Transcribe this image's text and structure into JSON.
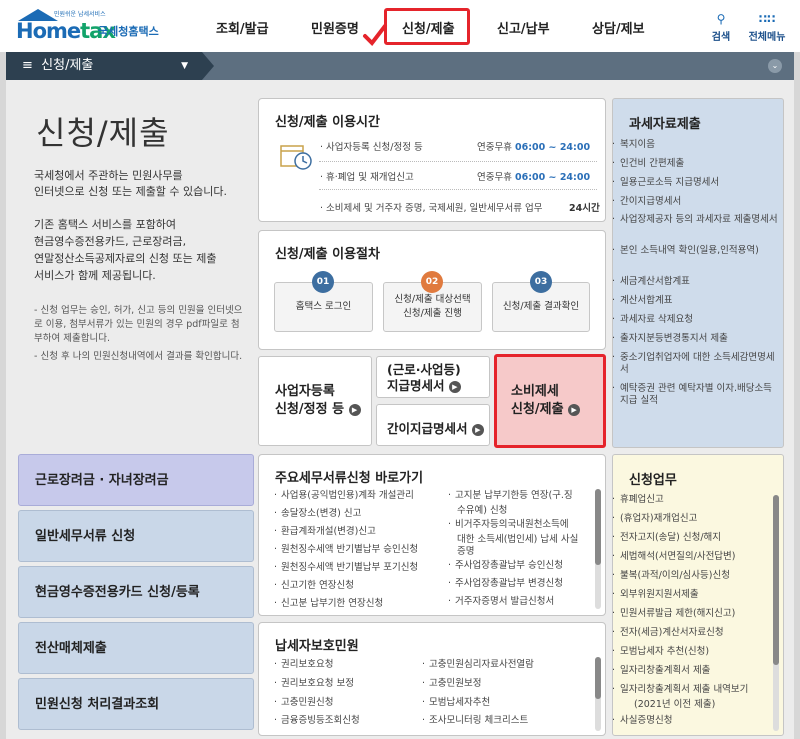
{
  "header": {
    "logo_word_a": "Home",
    "logo_word_b": "tax",
    "logo_small": "민원쉬운 납세서비스",
    "logo_kor": "국세청홈택스",
    "nav": [
      "조회/발급",
      "민원증명",
      "신청/제출",
      "신고/납부",
      "상담/제보"
    ],
    "search_label": "검색",
    "menu_label": "전체메뉴"
  },
  "sectionbar": {
    "title": "신청/제출"
  },
  "intro": {
    "title": "신청/제출",
    "line1": "국세청에서 주관하는 민원사무를",
    "line2": "인터넷으로 신청 또는 제출할 수 있습니다.",
    "line3": "기존 홈택스 서비스를 포함하여",
    "line4a": "현금영수증전용카드, 근로장려금,",
    "line5a": "연말정산소득공제자료의 신청 또는 제출",
    "line6": "서비스가 함께 제공됩니다.",
    "note1a": "- 신청 업무는 승인, 허가, 신고 등의 민원을 인터넷으",
    "note1b": "로 이용, 첨부서류가 있는 민원의 경우 pdf파일로 첨",
    "note1c": "부하여 제출합니다.",
    "note2": "- 신청 후 나의 민원신청내역에서 결과를 확인합니다."
  },
  "hours": {
    "title": "신청/제출 이용시간",
    "rows": [
      {
        "label": "사업자등록 신청/정정 등",
        "days": "연중무휴",
        "time": "06:00 ~ 24:00"
      },
      {
        "label": "휴·폐업 및 재개업신고",
        "days": "연중무휴",
        "time": "06:00 ~ 24:00"
      },
      {
        "label": "소비제세 및 거주자 증명, 국제세원, 일반세무서류 업무",
        "days": "",
        "time": "24시간"
      }
    ]
  },
  "procedure": {
    "title": "신청/제출 이용절차",
    "steps": [
      {
        "num": "01",
        "label": "홈택스 로그인",
        "color": "#3d6ea0"
      },
      {
        "num": "02",
        "label_a": "신청/제출 대상선택",
        "label_b": "신청/제출 진행",
        "color": "#e07a3e"
      },
      {
        "num": "03",
        "label": "신청/제출 결과확인",
        "color": "#3d6ea0"
      }
    ]
  },
  "quick": {
    "biz_a": "사업자등록",
    "biz_b": "신청/정정 등",
    "pay_a": "(근로·사업등)",
    "pay_b": "지급명세서",
    "simple": "간이지급명세서",
    "consume_a": "소비제세",
    "consume_b": "신청/제출"
  },
  "tax_data": {
    "title": "과세자료제출",
    "items": [
      "복지이음",
      "인건비 간편제출",
      "일용근로소득 지급명세서",
      "간이지급명세서",
      "사업장제공자 등의 과세자료 제출명세서",
      "본인 소득내역 확인(일용,인적용역)",
      "세금계산서합계표",
      "계산서합계표",
      "과세자료 삭제요청",
      "출자지분등변경통지서 제출",
      "중소기업취업자에 대한 소득세감면명세서",
      "예탁증권 관련 예탁자별 이자.배당소득 지급 실적"
    ]
  },
  "left_buttons": [
    "근로장려금 · 자녀장려금",
    "일반세무서류 신청",
    "현금영수증전용카드 신청/등록",
    "전산매체제출",
    "민원신청 처리결과조회"
  ],
  "major_docs": {
    "title": "주요세무서류신청 바로가기",
    "left": [
      "사업용(공익법인용)계좌 개설관리",
      "송달장소(변경) 신고",
      "환급계좌개설(변경)신고",
      "원천징수세액 반기별납부 승인신청",
      "원천징수세액 반기별납부 포기신청",
      "신고기한 연장신청",
      "신고분 납부기한 연장신청"
    ],
    "right_a": "고지분 납부기한등 연장(구.징",
    "right_b": "수유예) 신청",
    "right_c1": "비거주자등의국내원천소득에",
    "right_c2": "대한 소득세(법인세) 납세 사실",
    "right_c3": "증명",
    "right_d": "주사업장총괄납부 승인신청",
    "right_e": "주사업장총괄납부 변경신청",
    "right_f": "거주자증명서 발급신청서"
  },
  "protection": {
    "title": "납세자보호민원",
    "left": [
      "권리보호요청",
      "권리보호요청 보정",
      "고충민원신청",
      "금융증빙등조회신청"
    ],
    "right": [
      "고충민원심리자료사전열람",
      "고충민원보정",
      "모범납세자추천",
      "조사모니터링 체크리스트"
    ]
  },
  "apply_work": {
    "title": "신청업무",
    "items": [
      "휴폐업신고",
      "(휴업자)재개업신고",
      "전자고지(송달) 신청/해지",
      "세법해석(서면질의/사전답변)",
      "불복(과적/이의/심사등)신청",
      "외부위원지원서제출",
      "민원서류발급 제한(해지신고)",
      "전자(세금)계산서자료신청",
      "모범납세자 추천(신청)",
      "일자리창출계획서 제출",
      "일자리창출계획서 제출 내역보기",
      "(2021년 이전 제출)",
      "사실증명신청"
    ]
  },
  "colors": {
    "brand": "#1b6bb5",
    "highlight": "#e5242b",
    "bar": "#5d6f80",
    "lavender": "#c7c9eb",
    "lightblue": "#cfdceb",
    "cream": "#fbf8e0"
  }
}
